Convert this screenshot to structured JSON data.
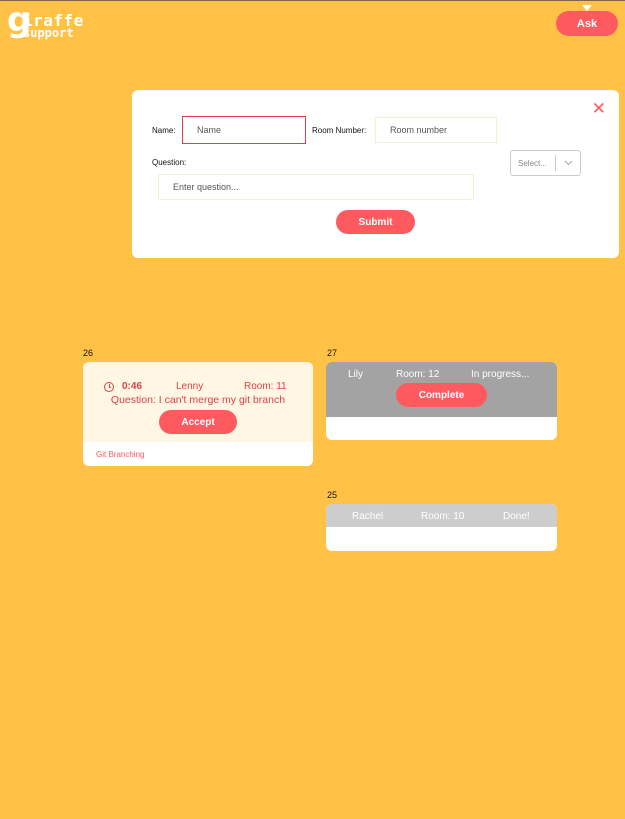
{
  "app": {
    "logo_big_letter": "g",
    "logo_line1": "iraffe",
    "logo_line2": "support",
    "ask_label": "Ask"
  },
  "form": {
    "close_glyph": "✕",
    "name_label": "Name:",
    "name_placeholder": "Name",
    "room_label": "Room Number:",
    "room_placeholder": "Room number",
    "question_label": "Question:",
    "question_placeholder": "Enter question...",
    "select_value": "Select...",
    "submit_label": "Submit"
  },
  "tickets": [
    {
      "number": "26",
      "timer": "0:46",
      "name": "Lenny",
      "room": "Room: 11",
      "question": "Question: I can't merge my git branch",
      "action_label": "Accept",
      "tag": "Git Branching"
    },
    {
      "number": "27",
      "name": "Lily",
      "room": "Room: 12",
      "status": "In progress...",
      "action_label": "Complete"
    },
    {
      "number": "25",
      "name": "Rachel",
      "room": "Room: 10",
      "status": "Done!"
    }
  ],
  "colors": {
    "background": "#FFC247",
    "accent": "#FF5A5F",
    "card_pending": "#FFF6E3",
    "card_in_progress": "#A3A3A3",
    "card_done": "#CDCDCD"
  },
  "icons": {
    "close": "close-icon",
    "timer": "clock-icon",
    "select": "chevron-down-icon"
  }
}
